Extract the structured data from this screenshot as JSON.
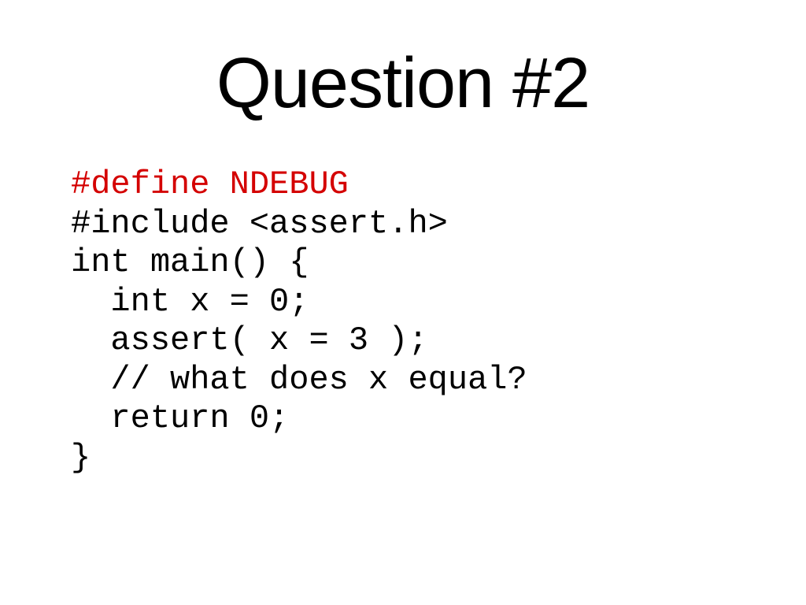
{
  "title": "Question #2",
  "code": {
    "line1": "#define NDEBUG",
    "line2": "#include <assert.h>",
    "line3": "int main() {",
    "line4": "  int x = 0;",
    "line5": "  assert( x = 3 );",
    "line6": "  // what does x equal?",
    "line7": "  return 0;",
    "line8": "}"
  }
}
